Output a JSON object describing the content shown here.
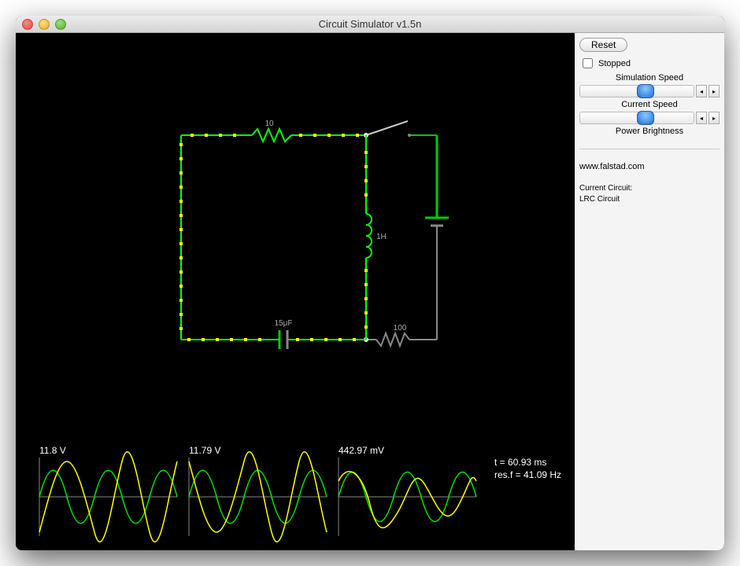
{
  "window": {
    "title": "Circuit Simulator v1.5n"
  },
  "sidebar": {
    "reset_label": "Reset",
    "stopped_label": "Stopped",
    "sim_speed_label": "Simulation Speed",
    "cur_speed_label": "Current Speed",
    "power_bright_label": "Power Brightness",
    "site_label": "www.falstad.com",
    "current_circuit_label": "Current Circuit:",
    "circuit_name": "LRC Circuit"
  },
  "circuit": {
    "resistor1_label": "10",
    "inductor_label": "1H",
    "capacitor_label": "15μF",
    "resistor2_label": "100"
  },
  "scopes": {
    "s1_label": "11.8 V",
    "s2_label": "11.79 V",
    "s3_label": "442.97 mV",
    "time_label": "t = 60.93 ms",
    "resf_label": "res.f = 41.09 Hz"
  }
}
